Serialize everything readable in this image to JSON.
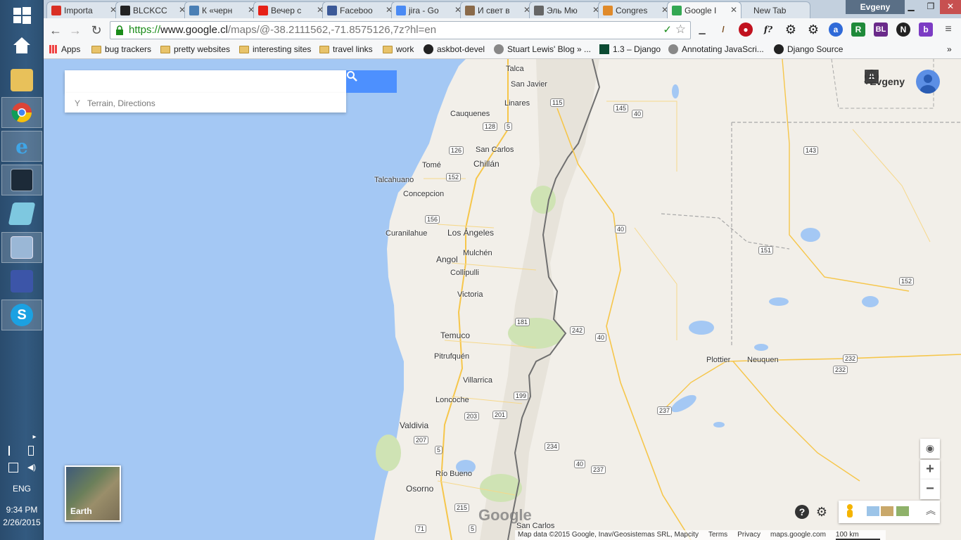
{
  "taskbar": {
    "pinned": [
      {
        "name": "home-icon"
      },
      {
        "name": "explorer-icon"
      },
      {
        "name": "chrome-icon"
      },
      {
        "name": "internet-explorer-icon"
      },
      {
        "name": "remote-desktop-icon"
      },
      {
        "name": "notes-icon"
      },
      {
        "name": "virtualbox-icon"
      },
      {
        "name": "putty-icon"
      },
      {
        "name": "skype-icon"
      }
    ],
    "tray": {
      "language": "ENG",
      "time": "9:34 PM",
      "date": "2/26/2015"
    }
  },
  "browser": {
    "tabs": [
      {
        "label": "Importa",
        "icon": "gmail-icon",
        "color": "#d93025"
      },
      {
        "label": "BLCKCC",
        "icon": "github-icon",
        "color": "#222222"
      },
      {
        "label": "К «черн",
        "icon": "livejournal-icon",
        "color": "#4a7fb5"
      },
      {
        "label": "Вечер с",
        "icon": "youtube-icon",
        "color": "#e62117"
      },
      {
        "label": "Faceboo",
        "icon": "facebook-icon",
        "color": "#3b5998"
      },
      {
        "label": "jira - Go",
        "icon": "google-search-icon",
        "color": "#4a8af4"
      },
      {
        "label": "И свет в",
        "icon": "portrait-icon",
        "color": "#8a6a4a"
      },
      {
        "label": "Эль Мю",
        "icon": "bag-icon",
        "color": "#666666"
      },
      {
        "label": "Congres",
        "icon": "pen-icon",
        "color": "#e08a2a"
      },
      {
        "label": "Google I",
        "icon": "google-maps-icon",
        "color": "#34a853",
        "active": true
      },
      {
        "label": "New Tab",
        "icon": "",
        "color": ""
      }
    ],
    "profile": "Evgeny",
    "url": {
      "scheme": "https://",
      "host": "www.google.cl",
      "path": "/maps/@-38.2111562,-71.8575126,7z?hl=en"
    },
    "bookmarks": [
      {
        "label": "Apps",
        "type": "apps"
      },
      {
        "label": "bug trackers",
        "type": "folder"
      },
      {
        "label": "pretty websites",
        "type": "folder"
      },
      {
        "label": "interesting sites",
        "type": "folder"
      },
      {
        "label": "travel links",
        "type": "folder"
      },
      {
        "label": "work",
        "type": "folder"
      },
      {
        "label": "askbot-devel",
        "type": "github"
      },
      {
        "label": "Stuart Lewis' Blog » ...",
        "type": "site"
      },
      {
        "label": "1.3 – Django",
        "type": "django"
      },
      {
        "label": "Annotating JavaScri...",
        "type": "site"
      },
      {
        "label": "Django Source",
        "type": "github"
      }
    ],
    "extensions": [
      "R",
      "BL",
      "N",
      "b"
    ]
  },
  "maps": {
    "search": {
      "value": "",
      "placeholder": ""
    },
    "suggestion": "Terrain, Directions",
    "account_name": "+Evgeny",
    "earth_label": "Earth",
    "logo": "Google",
    "footer": {
      "attribution": "Map data ©2015 Google, Inav/Geosistemas SRL, Mapcity",
      "terms": "Terms",
      "privacy": "Privacy",
      "site": "maps.google.com",
      "scale": "100 km"
    },
    "places": [
      {
        "name": "Talca"
      },
      {
        "name": "San Javier"
      },
      {
        "name": "Linares"
      },
      {
        "name": "Cauquenes"
      },
      {
        "name": "San Carlos"
      },
      {
        "name": "Tomé"
      },
      {
        "name": "Chillán"
      },
      {
        "name": "Talcahuano"
      },
      {
        "name": "Concepcion"
      },
      {
        "name": "Curanilahue"
      },
      {
        "name": "Los Ángeles"
      },
      {
        "name": "Mulchén"
      },
      {
        "name": "Angol"
      },
      {
        "name": "Collipulli"
      },
      {
        "name": "Victoria"
      },
      {
        "name": "Temuco"
      },
      {
        "name": "Pitrufquén"
      },
      {
        "name": "Villarrica"
      },
      {
        "name": "Loncoche"
      },
      {
        "name": "Valdivia"
      },
      {
        "name": "Río Bueno"
      },
      {
        "name": "Osorno"
      },
      {
        "name": "San Carlos"
      },
      {
        "name": "Plottier"
      },
      {
        "name": "Neuquen"
      }
    ],
    "routes": [
      "115",
      "145",
      "40",
      "128",
      "5",
      "126",
      "152",
      "156",
      "143",
      "40",
      "151",
      "152",
      "181",
      "242",
      "40",
      "232",
      "199",
      "237",
      "203",
      "201",
      "234",
      "207",
      "5",
      "40",
      "237",
      "215",
      "232",
      "71",
      "5"
    ]
  }
}
